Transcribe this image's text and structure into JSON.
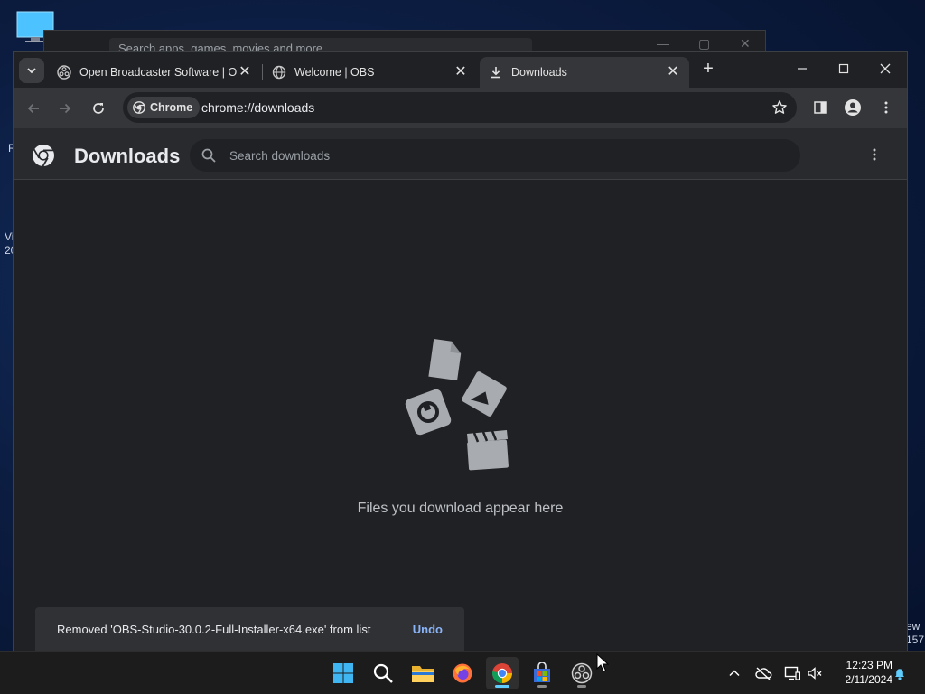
{
  "desktop": {
    "left_text_top": "R",
    "left_text_mid1": "Vi",
    "left_text_mid2": "20",
    "right_text_top": "ew",
    "right_text_bottom": "157"
  },
  "background_window": {
    "search_placeholder": "Search apps, games, movies and more"
  },
  "browser": {
    "tabs": [
      {
        "title": "Open Broadcaster Software | OBS",
        "icon": "obs-icon"
      },
      {
        "title": "Welcome | OBS",
        "icon": "globe-icon"
      },
      {
        "title": "Downloads",
        "icon": "download-icon"
      }
    ],
    "omnibox": {
      "chip_label": "Chrome",
      "url": "chrome://downloads"
    }
  },
  "downloads_page": {
    "title": "Downloads",
    "search_placeholder": "Search downloads",
    "empty_message": "Files you download appear here"
  },
  "toast": {
    "message": "Removed 'OBS-Studio-30.0.2-Full-Installer-x64.exe' from list",
    "action": "Undo"
  },
  "taskbar": {
    "apps": [
      "start",
      "search",
      "file-explorer",
      "firefox",
      "chrome",
      "microsoft-store",
      "obs-studio"
    ],
    "time": "12:23 PM",
    "date": "2/11/2024"
  },
  "colors": {
    "accent": "#8ab4f8",
    "page_bg": "#202124",
    "toolbar_bg": "#35363a",
    "taskbar_bg": "#1c1c1c"
  }
}
